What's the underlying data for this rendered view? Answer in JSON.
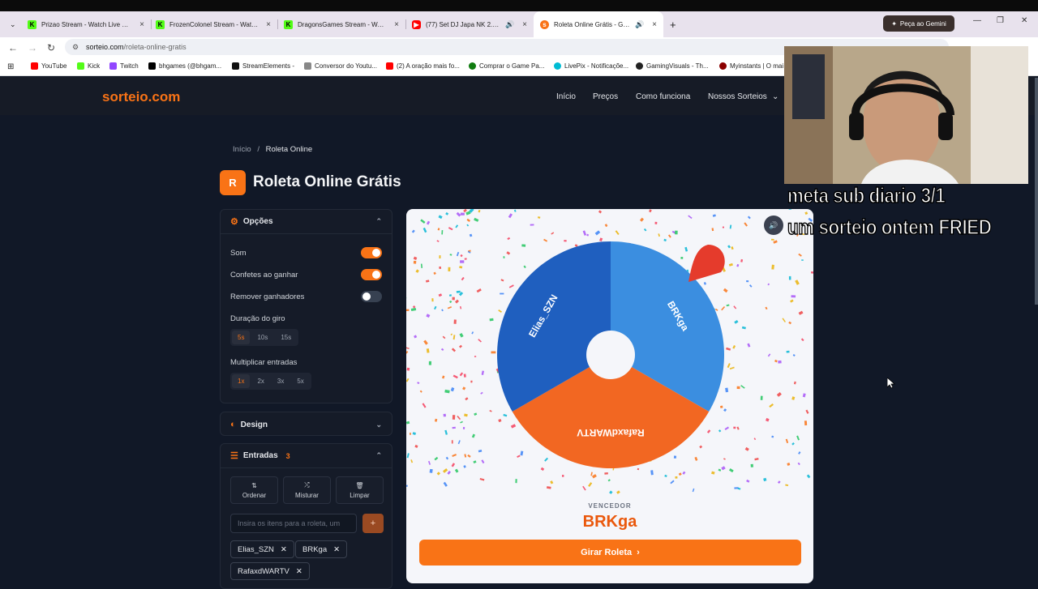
{
  "browser": {
    "tabs": [
      {
        "title": "Prizao Stream - Watch Live on K",
        "icon": "kick-icon",
        "color": "#53fc18"
      },
      {
        "title": "FrozenColonel Stream - Watch L",
        "icon": "kick-icon",
        "color": "#53fc18"
      },
      {
        "title": "DragonsGames Stream - Watch L",
        "icon": "kick-icon",
        "color": "#53fc18"
      },
      {
        "title": "(77) Set DJ Japa NK 2.0 Ryan",
        "icon": "youtube-icon",
        "color": "#ff0000"
      },
      {
        "title": "Roleta Online Grátis - Gire o",
        "icon": "sorteio-icon",
        "color": "#f97316"
      }
    ],
    "gemini_label": "Peça ao Gemini",
    "url_host": "sorteio.com",
    "url_path": "/roleta-online-gratis",
    "bookmarks": [
      {
        "label": "YouTube",
        "color": "#ff0000"
      },
      {
        "label": "Kick",
        "color": "#53fc18"
      },
      {
        "label": "Twitch",
        "color": "#9146ff"
      },
      {
        "label": "bhgames (@bhgam...",
        "color": "#000000"
      },
      {
        "label": "StreamElements -",
        "color": "#111111"
      },
      {
        "label": "Conversor do Youtu...",
        "color": "#888888"
      },
      {
        "label": "(2) A oração mais fo...",
        "color": "#ff0000"
      },
      {
        "label": "Comprar o Game Pa...",
        "color": "#107c10"
      },
      {
        "label": "LivePix - Notificaçõe...",
        "color": "#00bcd4"
      },
      {
        "label": "GamingVisuals - Th...",
        "color": "#222222"
      },
      {
        "label": "Myinstants | O mai",
        "color": "#8b0000"
      }
    ]
  },
  "site": {
    "logo": "sorteio.com",
    "nav": [
      "Início",
      "Preços",
      "Como funciona",
      "Nossos Sorteios"
    ],
    "breadcrumb_home": "Início",
    "breadcrumb_sep": "/",
    "breadcrumb_current": "Roleta Online",
    "title_badge": "R",
    "title": "Roleta Online Grátis"
  },
  "options": {
    "header": "Opções",
    "sound_label": "Som",
    "sound_on": true,
    "confetti_label": "Confetes ao ganhar",
    "confetti_on": true,
    "remove_label": "Remover ganhadores",
    "remove_on": false,
    "duration_label": "Duração do giro",
    "durations": [
      "5s",
      "10s",
      "15s"
    ],
    "duration_selected": "5s",
    "multiply_label": "Multiplicar entradas",
    "multipliers": [
      "1x",
      "2x",
      "3x",
      "5x"
    ],
    "multiplier_selected": "1x"
  },
  "design": {
    "header": "Design"
  },
  "entries": {
    "header": "Entradas",
    "count": "3",
    "sort_label": "Ordenar",
    "shuffle_label": "Misturar",
    "clear_label": "Limpar",
    "input_placeholder": "Insira os itens para a roleta, um",
    "add_label": "+",
    "items": [
      "Elias_SZN",
      "BRKga",
      "RafaxdWARTV"
    ]
  },
  "wheel": {
    "segments": [
      {
        "label": "BRKga",
        "color": "#3b8ee0"
      },
      {
        "label": "RafaxdWARTV",
        "color": "#f26722"
      },
      {
        "label": "Elias_SZN",
        "color": "#1f5fbf"
      }
    ],
    "winner_heading": "VENCEDOR",
    "winner_name": "BRKga",
    "spin_label": "Girar Roleta"
  },
  "overlay": {
    "line1": "meta sub diario 3/1",
    "line2": "um sorteio ontem FRIED"
  }
}
